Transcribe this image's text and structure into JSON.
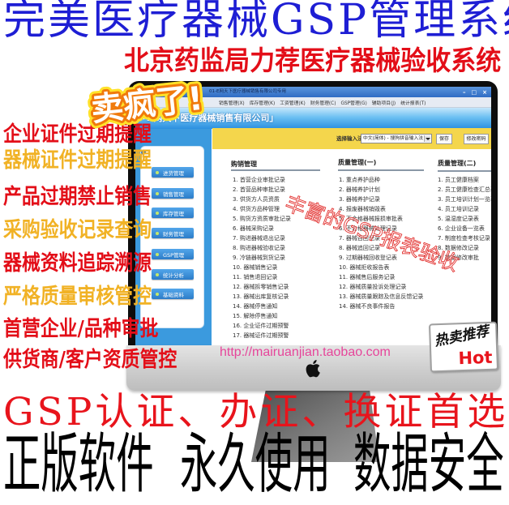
{
  "colors": {
    "title_blue": "#1e1ed4",
    "red": "#e30e18",
    "gold": "#f1b225",
    "url_pink": "#e6459a",
    "sidebar_blue": "#3b9ade",
    "toolbar_yellow": "#f4d64c",
    "tagline_red": "#e8141c",
    "hot_red": "#e8141c"
  },
  "headline": {
    "title": "完美医疗器械GSP管理系统",
    "subtitle": "北京药监局力荐医疗器械验收系统"
  },
  "sticker": {
    "text": "卖疯了!"
  },
  "features": [
    {
      "text": "企业证件过期提醒",
      "tone": "red"
    },
    {
      "text": "器械证件过期提醒",
      "tone": "gold"
    },
    {
      "text": "产品过期禁止销售",
      "tone": "red"
    },
    {
      "text": "采购验收记录查询",
      "tone": "gold"
    },
    {
      "text": "器械资料追踪溯源",
      "tone": "red"
    },
    {
      "text": "严格质量审核管控",
      "tone": "gold"
    },
    {
      "text": "首营企业/品种审批",
      "tone": "red"
    },
    {
      "text": "供货商/客户资质管控",
      "tone": "red"
    }
  ],
  "app_window": {
    "title": "01-E网天下医疗器械销售有限公司专用",
    "window_controls": {
      "minimize": "–",
      "maximize": "□",
      "close": "×"
    },
    "menu": [
      "销售管理(X)",
      "库存管理(K)",
      "工资管理(K)",
      "财务管理(C)",
      "GSP管理(G)",
      "辅助项目(J)",
      "统计报表(T)"
    ],
    "company_banner": "「E网天下医疗器械销售有限公司」",
    "sidebar": [
      "进货管理",
      "销售管理",
      "库存管理",
      "财务管理",
      "GSP管理",
      "统计分析",
      "基础资料"
    ],
    "toolbar": {
      "ime_label": "选择输入法",
      "ime_value": "中文(简体) - 搜狗拼音输入法",
      "save_label": "保存",
      "change_password_label": "修改密码"
    },
    "columns": [
      {
        "heading": "购销管理",
        "items": [
          "1. 首营企业审批记录",
          "2. 首营品种审批记录",
          "3. 供货方人员资质",
          "4. 供货方品种管理",
          "5. 购货方资质审批记录",
          "6. 器械采购记录",
          "7. 购进器械退出记录",
          "8. 购进器械验收记录",
          "9. 冷链器械到货记录",
          "10. 器械销售记录",
          "11. 销售退回记录",
          "12. 器械拆零销售记录",
          "13. 器械出库复核记录",
          "14. 器械停售通知",
          "15. 解除停售通知",
          "16. 企业证件过期预警",
          "17. 器械证件过期预警"
        ]
      },
      {
        "heading": "质量管理(一)",
        "items": [
          "1. 重点养护品种",
          "2. 器械养护计划",
          "3. 器械养护记录",
          "4. 报废器械销毁表",
          "5. 不合格器械报损审批表",
          "6. 不合格器械处理记录",
          "7. 器械召回记录",
          "8. 器械追回记录",
          "9. 过期器械回收登记表",
          "10. 器械拒收报告表",
          "11. 器械售后服务记录",
          "12. 器械质量投诉处理记录",
          "13. 器械质量跟踪及信息反馈记录",
          "14. 器械不良事件报告"
        ]
      },
      {
        "heading": "质量管理(二)",
        "items": [
          "1. 员工健康档案",
          "2. 员工健康检查汇总表",
          "3. 员工培训计划一览表",
          "4. 员工培训记录",
          "5. 温湿度记录表",
          "6. 企业设备一览表",
          "7. 制度检查考核记录",
          "8. 数据修改记录",
          "9. 数据修改审批"
        ]
      }
    ],
    "watermark": "丰富的GSP报表验收"
  },
  "url": "http://mairuanjian.taobao.com",
  "hot_badge": {
    "line1": "热卖推荐",
    "line2": "Hot"
  },
  "tagline": "GSP认证、办证、换证首选",
  "slogans": [
    "正版软件",
    "永久使用",
    "数据安全"
  ]
}
